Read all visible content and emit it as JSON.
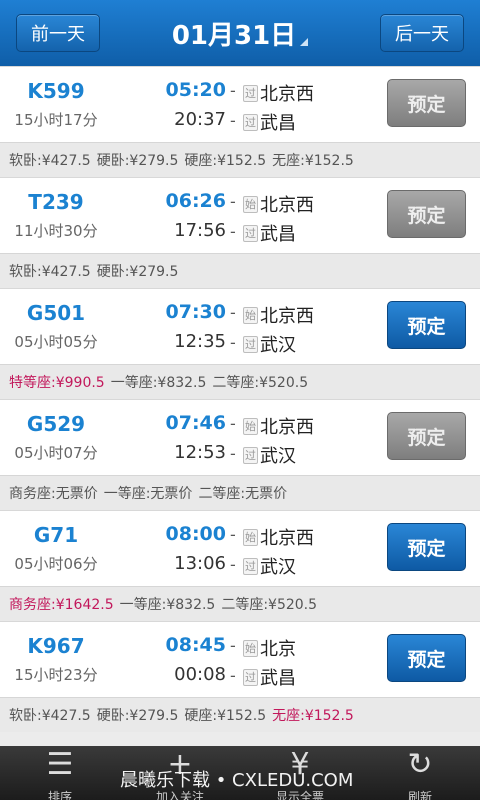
{
  "header": {
    "prev_label": "前一天",
    "date": "01月31日",
    "next_label": "后一天"
  },
  "trains": [
    {
      "no": "K599",
      "duration": "15小时17分",
      "dep_time": "05:20",
      "arr_time": "20:37",
      "dep_badge": "过",
      "from": "北京西",
      "arr_badge": "过",
      "to": "武昌",
      "book_label": "预定",
      "bookable": false,
      "prices": [
        {
          "text": "软卧:¥427.5",
          "red": false
        },
        {
          "text": "硬卧:¥279.5",
          "red": false
        },
        {
          "text": "硬座:¥152.5",
          "red": false
        },
        {
          "text": "无座:¥152.5",
          "red": false
        }
      ]
    },
    {
      "no": "T239",
      "duration": "11小时30分",
      "dep_time": "06:26",
      "arr_time": "17:56",
      "dep_badge": "始",
      "from": "北京西",
      "arr_badge": "过",
      "to": "武昌",
      "book_label": "预定",
      "bookable": false,
      "prices": [
        {
          "text": "软卧:¥427.5",
          "red": false
        },
        {
          "text": "硬卧:¥279.5",
          "red": false
        }
      ]
    },
    {
      "no": "G501",
      "duration": "05小时05分",
      "dep_time": "07:30",
      "arr_time": "12:35",
      "dep_badge": "始",
      "from": "北京西",
      "arr_badge": "过",
      "to": "武汉",
      "book_label": "预定",
      "bookable": true,
      "prices": [
        {
          "text": "特等座:¥990.5",
          "red": true
        },
        {
          "text": "一等座:¥832.5",
          "red": false
        },
        {
          "text": "二等座:¥520.5",
          "red": false
        }
      ]
    },
    {
      "no": "G529",
      "duration": "05小时07分",
      "dep_time": "07:46",
      "arr_time": "12:53",
      "dep_badge": "始",
      "from": "北京西",
      "arr_badge": "过",
      "to": "武汉",
      "book_label": "预定",
      "bookable": false,
      "prices": [
        {
          "text": "商务座:无票价",
          "red": false
        },
        {
          "text": "一等座:无票价",
          "red": false
        },
        {
          "text": "二等座:无票价",
          "red": false
        }
      ]
    },
    {
      "no": "G71",
      "duration": "05小时06分",
      "dep_time": "08:00",
      "arr_time": "13:06",
      "dep_badge": "始",
      "from": "北京西",
      "arr_badge": "过",
      "to": "武汉",
      "book_label": "预定",
      "bookable": true,
      "prices": [
        {
          "text": "商务座:¥1642.5",
          "red": true
        },
        {
          "text": "一等座:¥832.5",
          "red": false
        },
        {
          "text": "二等座:¥520.5",
          "red": false
        }
      ]
    },
    {
      "no": "K967",
      "duration": "15小时23分",
      "dep_time": "08:45",
      "arr_time": "00:08",
      "dep_badge": "始",
      "from": "北京",
      "arr_badge": "过",
      "to": "武昌",
      "book_label": "预定",
      "bookable": true,
      "prices": [
        {
          "text": "软卧:¥427.5",
          "red": false
        },
        {
          "text": "硬卧:¥279.5",
          "red": false
        },
        {
          "text": "硬座:¥152.5",
          "red": false
        },
        {
          "text": "无座:¥152.5",
          "red": true
        }
      ]
    }
  ],
  "footer": {
    "watermark": "晨曦乐下载 • CXLEDU.COM",
    "items": [
      {
        "icon": "sort-icon",
        "label": "排序"
      },
      {
        "icon": "add-icon",
        "label": "加入关注"
      },
      {
        "icon": "yuan-icon",
        "label": "显示全票"
      },
      {
        "icon": "refresh-icon",
        "label": "刷新"
      }
    ]
  }
}
